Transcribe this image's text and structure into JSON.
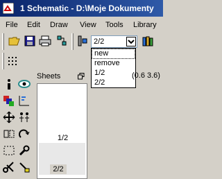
{
  "window": {
    "title": "1 Schematic - D:\\Moje Dokumenty"
  },
  "menubar": {
    "items": [
      "File",
      "Edit",
      "Draw",
      "View",
      "Tools",
      "Library"
    ]
  },
  "toolbar": {
    "sheet_combo": {
      "value": "2/2"
    },
    "sheet_dropdown": {
      "options": [
        "new",
        "remove",
        "1/2",
        "2/2"
      ],
      "highlighted": "new"
    }
  },
  "sheets_panel": {
    "title": "Sheets",
    "thumbnail_label": "1/2",
    "selected_label": "2/2"
  },
  "status": {
    "coords": "(0.6 3.6)"
  }
}
